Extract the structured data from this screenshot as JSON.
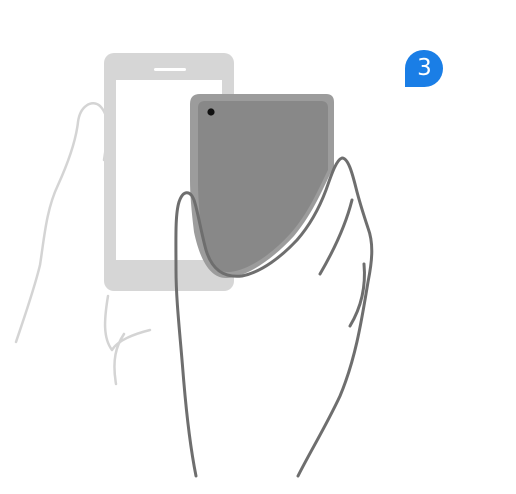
{
  "step": {
    "number": "3"
  },
  "colors": {
    "badge": "#1a7ee6",
    "faded_outline": "#d4d4d4",
    "hand_outline": "#6e6e6e",
    "phone_back": "#888888",
    "phone_back_rim": "#9a9a9a",
    "camera": "#111111"
  },
  "icons": {
    "faded_hand": "hand-outline-icon",
    "faded_phone": "smartphone-front-icon",
    "phone_back": "smartphone-back-icon",
    "hand": "hand-outline-icon",
    "camera": "camera-lens-icon"
  }
}
